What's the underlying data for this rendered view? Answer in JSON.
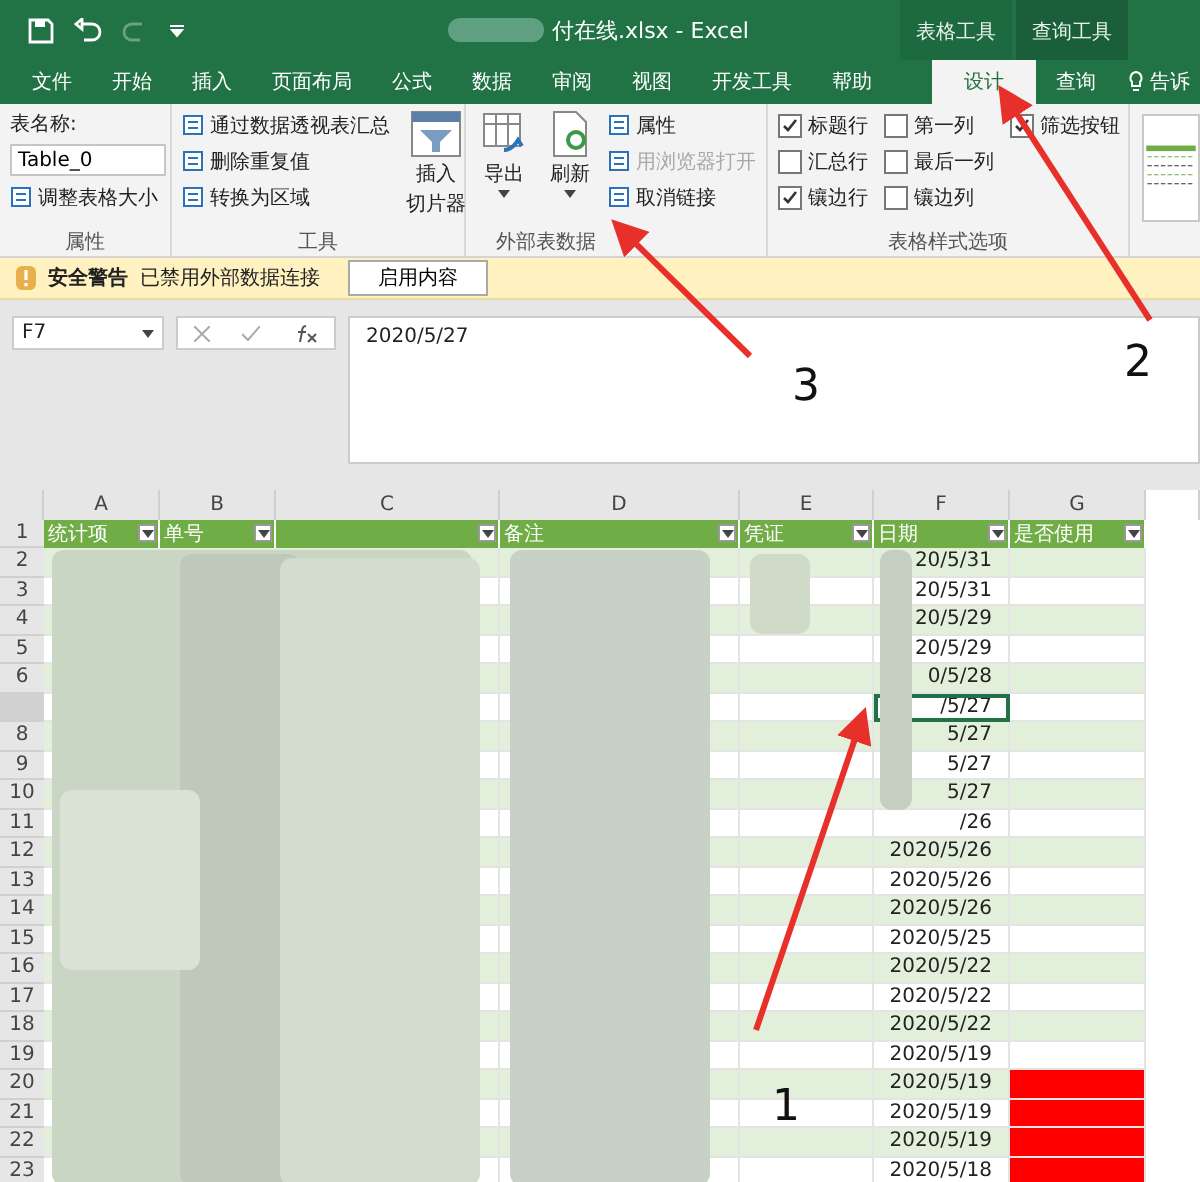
{
  "title_bar": {
    "title": "付在线.xlsx  -  Excel",
    "context_tabs": [
      "表格工具",
      "查询工具"
    ]
  },
  "tabs": [
    {
      "label": "文件",
      "selected": false
    },
    {
      "label": "开始",
      "selected": false
    },
    {
      "label": "插入",
      "selected": false
    },
    {
      "label": "页面布局",
      "selected": false
    },
    {
      "label": "公式",
      "selected": false
    },
    {
      "label": "数据",
      "selected": false
    },
    {
      "label": "审阅",
      "selected": false
    },
    {
      "label": "视图",
      "selected": false
    },
    {
      "label": "开发工具",
      "selected": false
    },
    {
      "label": "帮助",
      "selected": false
    },
    {
      "label": "设计",
      "selected": true
    },
    {
      "label": "查询",
      "selected": false
    }
  ],
  "tell_me": "告诉",
  "properties_group": {
    "label": "属性",
    "name_label": "表名称:",
    "name_value": "Table_0",
    "resize": "调整表格大小"
  },
  "tools_group": {
    "label": "工具",
    "items": [
      "通过数据透视表汇总",
      "删除重复值",
      "转换为区域"
    ],
    "slicer_lines": [
      "插入",
      "切片器"
    ]
  },
  "external_group": {
    "label": "外部表数据",
    "export": "导出",
    "refresh": "刷新",
    "items": [
      {
        "label": "属性",
        "disabled": false
      },
      {
        "label": "用浏览器打开",
        "disabled": true
      },
      {
        "label": "取消链接",
        "disabled": false
      }
    ]
  },
  "style_options": {
    "label": "表格样式选项",
    "options": [
      {
        "label": "标题行",
        "checked": true
      },
      {
        "label": "汇总行",
        "checked": false
      },
      {
        "label": "镶边行",
        "checked": true
      },
      {
        "label": "第一列",
        "checked": false
      },
      {
        "label": "最后一列",
        "checked": false
      },
      {
        "label": "镶边列",
        "checked": false
      },
      {
        "label": "筛选按钮",
        "checked": true
      }
    ]
  },
  "security_bar": {
    "title": "安全警告",
    "message": "已禁用外部数据连接",
    "button": "启用内容"
  },
  "formula_bar": {
    "name_box": "F7",
    "formula": "2020/5/27"
  },
  "sheet": {
    "columns": [
      {
        "letter": "A",
        "title": "统计项"
      },
      {
        "letter": "B",
        "title": "单号"
      },
      {
        "letter": "C"
      },
      {
        "letter": "D",
        "title": "备注"
      },
      {
        "letter": "E",
        "title": "凭证"
      },
      {
        "letter": "F",
        "title": "日期"
      },
      {
        "letter": "G",
        "title": "是否使用"
      }
    ],
    "header_row_number": "1",
    "rows": [
      {
        "number": "2",
        "date": "20/5/31",
        "selected": false,
        "highlighted": false
      },
      {
        "number": "3",
        "date": "20/5/31",
        "selected": false,
        "highlighted": false
      },
      {
        "number": "4",
        "date": "20/5/29",
        "selected": false,
        "highlighted": false
      },
      {
        "number": "5",
        "date": "20/5/29",
        "selected": false,
        "highlighted": false
      },
      {
        "number": "6",
        "date": "0/5/28",
        "selected": false,
        "highlighted": false
      },
      {
        "date": "/5/27",
        "selected": true,
        "highlighted": false
      },
      {
        "number": "8",
        "date": "5/27",
        "selected": false,
        "highlighted": false
      },
      {
        "number": "9",
        "date": "5/27",
        "selected": false,
        "highlighted": false
      },
      {
        "number": "10",
        "date": "5/27",
        "selected": false,
        "highlighted": false
      },
      {
        "number": "11",
        "date": "/26",
        "selected": false,
        "highlighted": false
      },
      {
        "number": "12",
        "date": "2020/5/26",
        "selected": false,
        "highlighted": false
      },
      {
        "number": "13",
        "date": "2020/5/26",
        "selected": false,
        "highlighted": false
      },
      {
        "number": "14",
        "date": "2020/5/26",
        "selected": false,
        "highlighted": false
      },
      {
        "number": "15",
        "date": "2020/5/25",
        "selected": false,
        "highlighted": false
      },
      {
        "number": "16",
        "date": "2020/5/22",
        "selected": false,
        "highlighted": false
      },
      {
        "number": "17",
        "date": "2020/5/22",
        "selected": false,
        "highlighted": false
      },
      {
        "number": "18",
        "date": "2020/5/22",
        "selected": false,
        "highlighted": false
      },
      {
        "number": "19",
        "date": "2020/5/19",
        "selected": false,
        "highlighted": false
      },
      {
        "number": "20",
        "date": "2020/5/19",
        "selected": false,
        "highlighted": true
      },
      {
        "number": "21",
        "date": "2020/5/19",
        "selected": false,
        "highlighted": true
      },
      {
        "number": "22",
        "date": "2020/5/19",
        "selected": false,
        "highlighted": true
      },
      {
        "number": "23",
        "date": "2020/5/18",
        "selected": false,
        "highlighted": true
      }
    ]
  },
  "annotations": [
    {
      "number": "1"
    },
    {
      "number": "2"
    },
    {
      "number": "3"
    }
  ]
}
